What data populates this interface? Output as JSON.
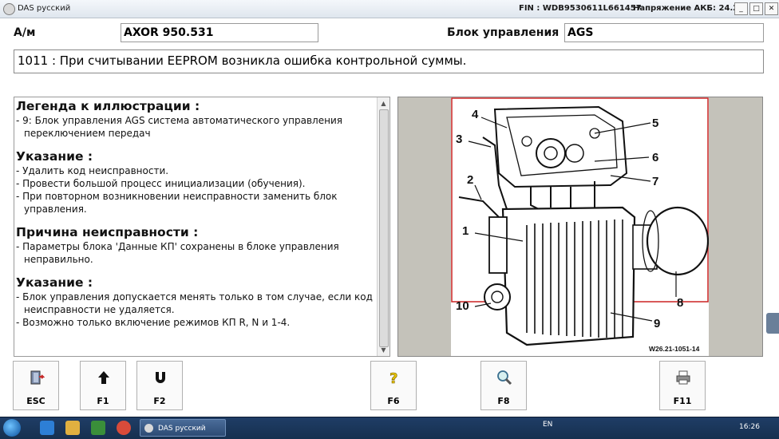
{
  "window": {
    "title": "DAS русский",
    "fin": "FIN : WDB9530611L661457",
    "voltage": "Напряжение АКБ: 24.2 V",
    "controls": [
      "_",
      "□",
      "✕"
    ]
  },
  "header": {
    "vehicle_label": "А/м",
    "vehicle_value": "AXOR 950.531",
    "unit_label": "Блок управления",
    "unit_value": "AGS"
  },
  "error_message": "1011 : При считывании EEPROM возникла ошибка контрольной суммы.",
  "sections": [
    {
      "heading": "Легенда к иллюстрации :",
      "items": [
        "- 9: Блок управления AGS система автоматического управления переключением передач"
      ]
    },
    {
      "heading": "Указание :",
      "items": [
        "- Удалить код неисправности.",
        "- Провести большой процесс инициализации (обучения).",
        "- При повторном возникновении неисправности заменить блок управления."
      ]
    },
    {
      "heading": "Причина неисправности :",
      "items": [
        "- Параметры блока 'Данные КП' сохранены в блоке управления неправильно."
      ]
    },
    {
      "heading": "Указание :",
      "items": [
        "- Блок управления допускается менять только в том случае, если код неисправности не удаляется.",
        "- Возможно только включение режимов КП R, N и 1-4."
      ]
    }
  ],
  "figure": {
    "callouts": [
      "1",
      "2",
      "3",
      "4",
      "5",
      "6",
      "7",
      "8",
      "9",
      "10"
    ],
    "caption": "W26.21-1051-14"
  },
  "footer_buttons": [
    {
      "label": "ESC",
      "icon": "exit-door-icon"
    },
    {
      "label": "F1",
      "icon": "arrow-up-icon"
    },
    {
      "label": "F2",
      "icon": "magnet-icon"
    },
    {
      "label": "F6",
      "icon": "help-question-icon"
    },
    {
      "label": "F8",
      "icon": "magnifier-icon"
    },
    {
      "label": "F11",
      "icon": "printer-icon"
    }
  ],
  "taskbar": {
    "app_label": "DAS русский",
    "lang": "EN",
    "clock": "16:26"
  }
}
